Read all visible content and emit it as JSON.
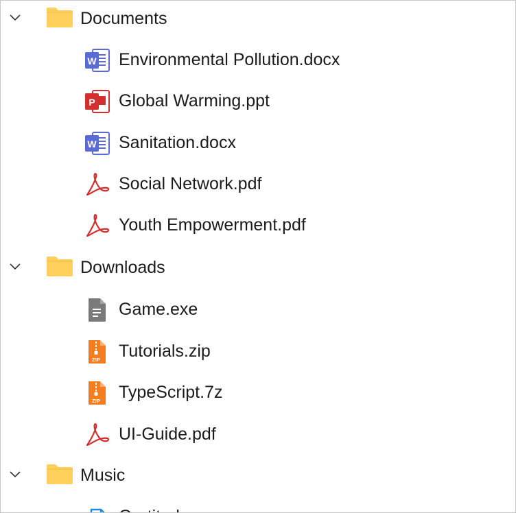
{
  "tree": {
    "folders": [
      {
        "name": "Documents",
        "expanded": true,
        "files": [
          {
            "name": "Environmental Pollution.docx",
            "icon": "word-icon"
          },
          {
            "name": "Global Warming.ppt",
            "icon": "powerpoint-icon"
          },
          {
            "name": "Sanitation.docx",
            "icon": "word-icon"
          },
          {
            "name": "Social Network.pdf",
            "icon": "pdf-icon"
          },
          {
            "name": "Youth Empowerment.pdf",
            "icon": "pdf-icon"
          }
        ]
      },
      {
        "name": "Downloads",
        "expanded": true,
        "files": [
          {
            "name": "Game.exe",
            "icon": "exe-file-icon"
          },
          {
            "name": "Tutorials.zip",
            "icon": "zip-icon"
          },
          {
            "name": "TypeScript.7z",
            "icon": "zip-icon"
          },
          {
            "name": "UI-Guide.pdf",
            "icon": "pdf-icon"
          }
        ]
      },
      {
        "name": "Music",
        "expanded": true,
        "files": [
          {
            "name": "Gratitude",
            "icon": "music-file-icon"
          }
        ]
      }
    ]
  },
  "icon_text": {
    "word": "W",
    "ppt": "P",
    "zip": "ZIP"
  },
  "colors": {
    "folder": "#FFD15C",
    "word": "#5B6BD6",
    "ppt": "#D32F2F",
    "pdf": "#D32F2F",
    "zip": "#F57C1F",
    "exe": "#7A7A7A",
    "music": "#1E88E5",
    "text": "#1b1b1b"
  }
}
